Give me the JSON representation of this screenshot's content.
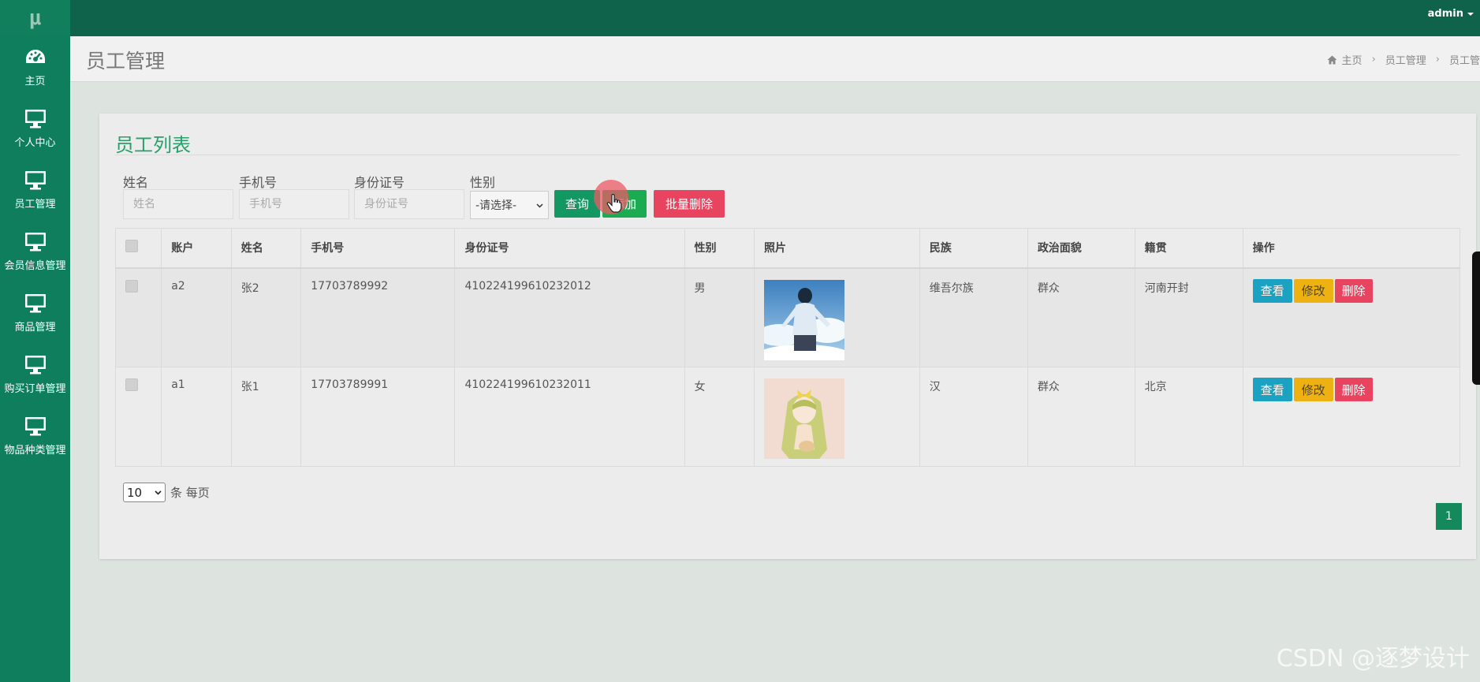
{
  "app": {
    "logo": "μ",
    "user": "admin"
  },
  "sidebar": {
    "items": [
      {
        "label": "主页",
        "icon": "dashboard-icon"
      },
      {
        "label": "个人中心",
        "icon": "monitor-icon"
      },
      {
        "label": "员工管理",
        "icon": "monitor-icon"
      },
      {
        "label": "会员信息管理",
        "icon": "monitor-icon"
      },
      {
        "label": "商品管理",
        "icon": "monitor-icon"
      },
      {
        "label": "购买订单管理",
        "icon": "monitor-icon"
      },
      {
        "label": "物品种类管理",
        "icon": "monitor-icon"
      }
    ]
  },
  "header": {
    "title": "员工管理",
    "breadcrumb": [
      "主页",
      "员工管理",
      "员工管"
    ]
  },
  "panel": {
    "title": "员工列表"
  },
  "search": {
    "name_label": "姓名",
    "name_placeholder": "姓名",
    "phone_label": "手机号",
    "phone_placeholder": "手机号",
    "id_label": "身份证号",
    "id_placeholder": "身份证号",
    "gender_label": "性别",
    "gender_selected": "-请选择-",
    "query_button": "查询",
    "add_button": "添加",
    "batch_delete_button": "批量删除"
  },
  "table": {
    "columns": [
      "账户",
      "姓名",
      "手机号",
      "身份证号",
      "性别",
      "照片",
      "民族",
      "政治面貌",
      "籍贯",
      "操作"
    ],
    "rows": [
      {
        "account": "a2",
        "name": "张2",
        "phone": "17703789992",
        "id_number": "410224199610232012",
        "gender": "男",
        "ethnicity": "维吾尔族",
        "political": "群众",
        "hometown": "河南开封"
      },
      {
        "account": "a1",
        "name": "张1",
        "phone": "17703789991",
        "id_number": "410224199610232011",
        "gender": "女",
        "ethnicity": "汉",
        "political": "群众",
        "hometown": "北京"
      }
    ],
    "actions": {
      "view": "查看",
      "edit": "修改",
      "delete": "删除"
    }
  },
  "pagination": {
    "page_size": "10",
    "page_size_suffix": "条 每页",
    "current_page": "1"
  },
  "watermark": "CSDN @逐梦设计",
  "colors": {
    "topbar": "#10634b",
    "sidebar": "#0f7e5d",
    "accent": "#27a06b",
    "danger": "#e8445f",
    "warning": "#edb112",
    "info": "#1ba1c1"
  }
}
